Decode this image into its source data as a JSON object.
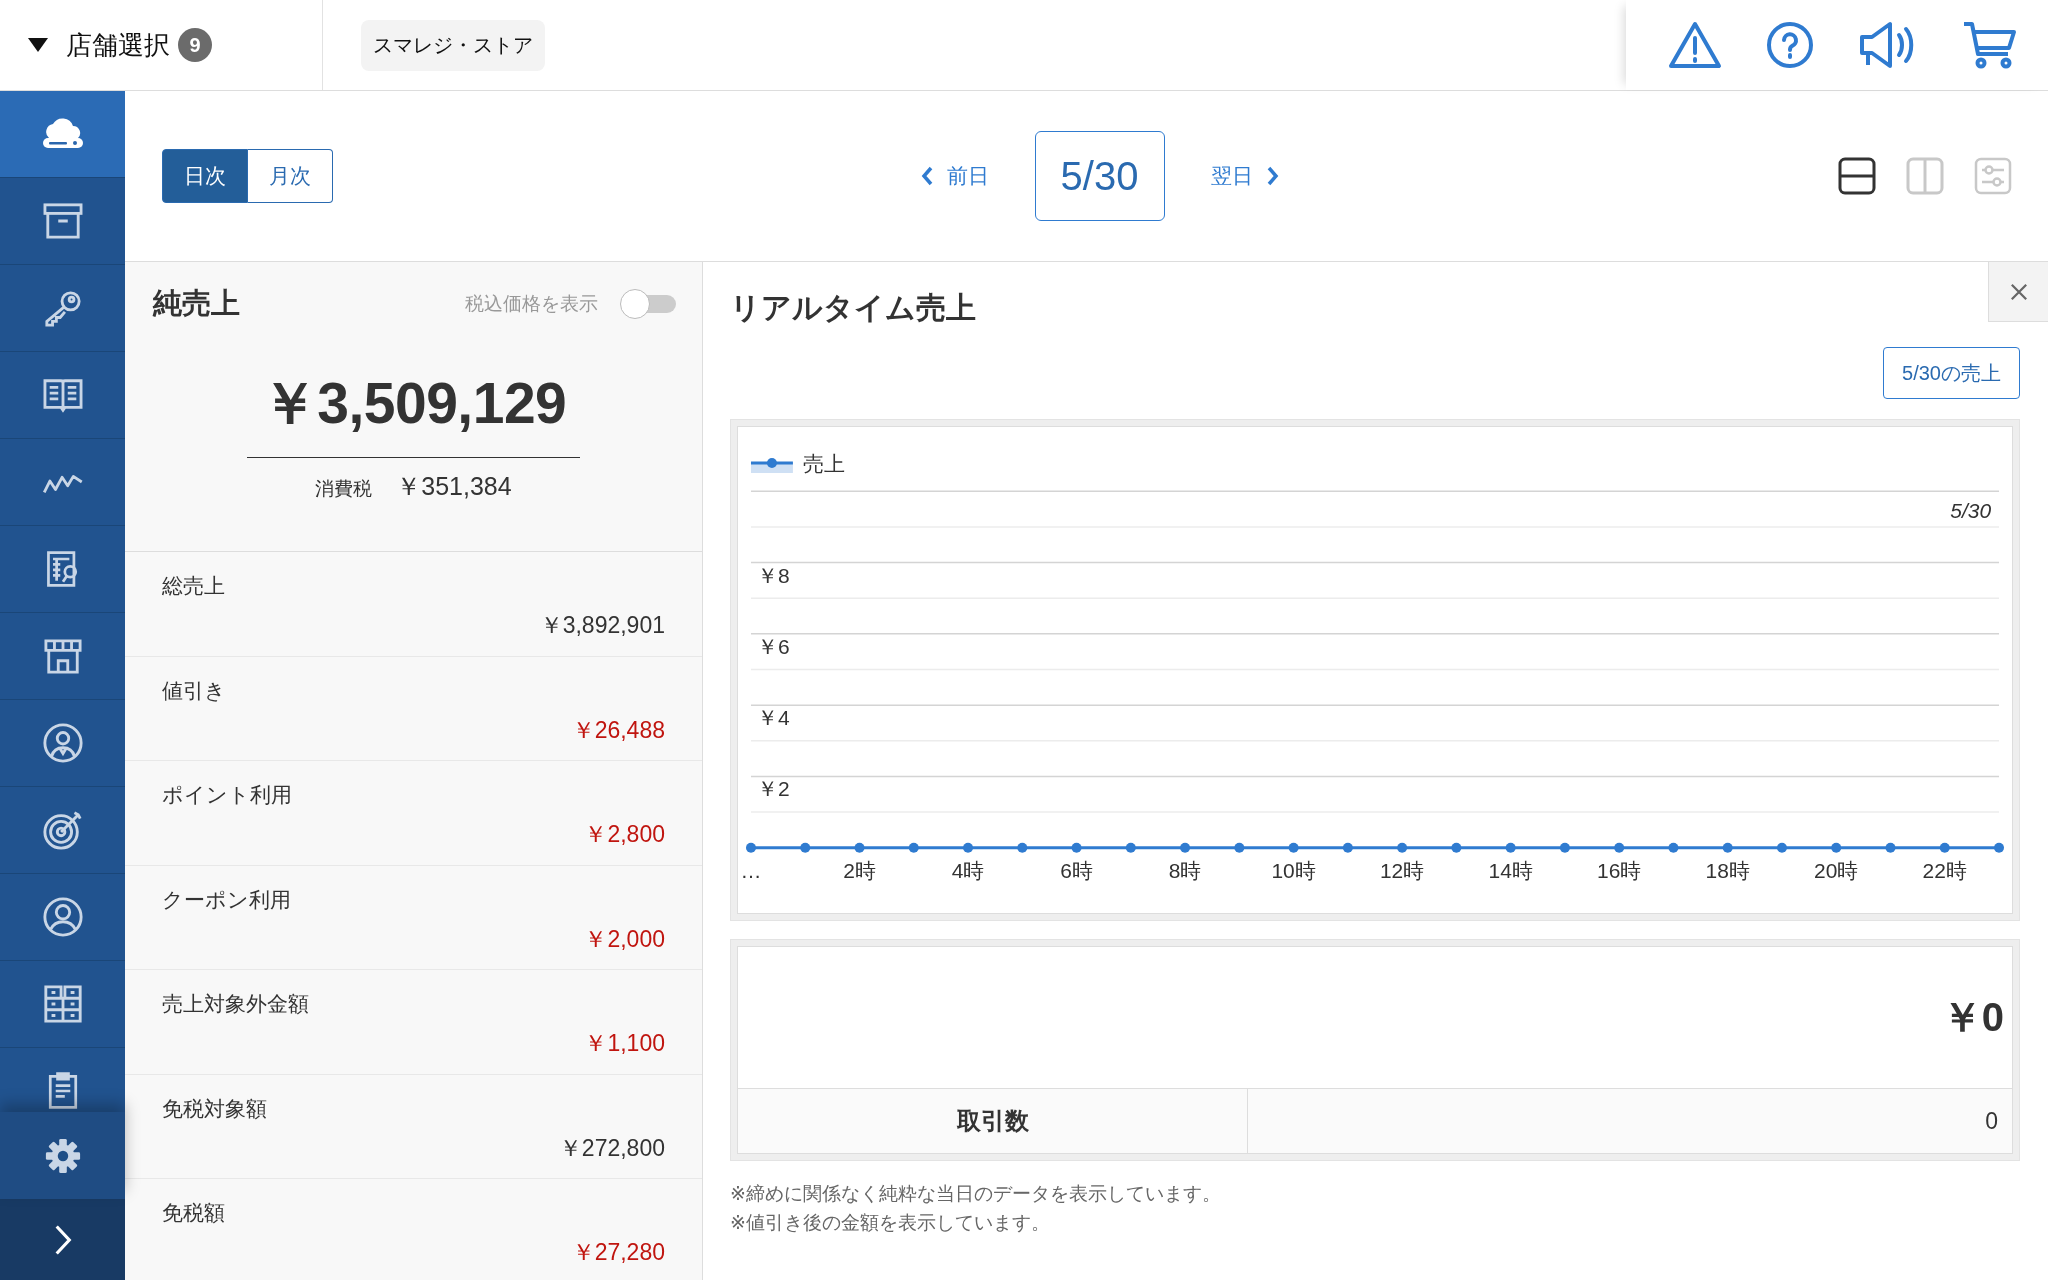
{
  "top_bar": {
    "store_select": {
      "label": "店舗選択",
      "count": "9"
    },
    "store_chip": "スマレジ・ストア",
    "actions": [
      {
        "kind": "warning"
      },
      {
        "kind": "help"
      },
      {
        "kind": "announce"
      },
      {
        "kind": "cart"
      }
    ]
  },
  "sidebar": {
    "items": [
      {
        "kind": "cloud",
        "selected": true
      },
      {
        "kind": "archive",
        "selected": false
      },
      {
        "kind": "key",
        "selected": false
      },
      {
        "kind": "book",
        "selected": false
      },
      {
        "kind": "trend",
        "selected": false
      },
      {
        "kind": "report",
        "selected": false
      },
      {
        "kind": "store",
        "selected": false
      },
      {
        "kind": "staff",
        "selected": false
      },
      {
        "kind": "target",
        "selected": false
      },
      {
        "kind": "user",
        "selected": false
      },
      {
        "kind": "grid",
        "selected": false
      },
      {
        "kind": "clipboard",
        "selected": false
      }
    ]
  },
  "period_tabs": [
    {
      "label": "日次",
      "selected": true
    },
    {
      "label": "月次",
      "selected": false
    }
  ],
  "date_nav": {
    "prev": "前日",
    "date": "5/30",
    "next": "翌日"
  },
  "view_modes": [
    {
      "kind": "rows",
      "selected": true
    },
    {
      "kind": "columns",
      "selected": false
    },
    {
      "kind": "sliders",
      "selected": false
    }
  ],
  "net_sales": {
    "title": "純売上",
    "tax_toggle": {
      "label": "税込価格を表示",
      "on": false
    },
    "amount": "￥3,509,129",
    "tax_label": "消費税",
    "tax_amount": "￥351,384",
    "rows": [
      {
        "label": "総売上",
        "value": "￥3,892,901",
        "color": "#333333"
      },
      {
        "label": "値引き",
        "value": "￥26,488",
        "color": "#c0150f"
      },
      {
        "label": "ポイント利用",
        "value": "￥2,800",
        "color": "#c0150f"
      },
      {
        "label": "クーポン利用",
        "value": "￥2,000",
        "color": "#c0150f"
      },
      {
        "label": "売上対象外金額",
        "value": "￥1,100",
        "color": "#c0150f"
      },
      {
        "label": "免税対象額",
        "value": "￥272,800",
        "color": "#333333"
      },
      {
        "label": "免税額",
        "value": "￥27,280",
        "color": "#c0150f"
      }
    ]
  },
  "realtime": {
    "title": "リアルタイム売上",
    "day_button": "5/30の売上",
    "chart_data": {
      "type": "line",
      "x": [
        0,
        1,
        2,
        3,
        4,
        5,
        6,
        7,
        8,
        9,
        10,
        11,
        12,
        13,
        14,
        15,
        16,
        17,
        18,
        19,
        20,
        21,
        22,
        23
      ],
      "series": [
        {
          "name": "売上",
          "color": "#2f7bd0",
          "marker": true,
          "values": [
            0,
            0,
            0,
            0,
            0,
            0,
            0,
            0,
            0,
            0,
            0,
            0,
            0,
            0,
            0,
            0,
            0,
            0,
            0,
            0,
            0,
            0,
            0,
            0
          ]
        }
      ],
      "xlim": [
        0,
        23
      ],
      "ylim": [
        0,
        10
      ],
      "grid": true,
      "xticks": [
        {
          "value": 0,
          "label": "…"
        },
        {
          "value": 2,
          "label": "2時"
        },
        {
          "value": 4,
          "label": "4時"
        },
        {
          "value": 6,
          "label": "6時"
        },
        {
          "value": 8,
          "label": "8時"
        },
        {
          "value": 10,
          "label": "10時"
        },
        {
          "value": 12,
          "label": "12時"
        },
        {
          "value": 14,
          "label": "14時"
        },
        {
          "value": 16,
          "label": "16時"
        },
        {
          "value": 18,
          "label": "18時"
        },
        {
          "value": 20,
          "label": "20時"
        },
        {
          "value": 22,
          "label": "22時"
        }
      ],
      "yticks": [
        {
          "value": 2,
          "label": "￥2"
        },
        {
          "value": 4,
          "label": "￥4"
        },
        {
          "value": 6,
          "label": "￥6"
        },
        {
          "value": 8,
          "label": "￥8"
        }
      ],
      "annotations": [
        "5/30"
      ]
    },
    "total": "￥0",
    "transactions_label": "取引数",
    "transactions": "0",
    "notes": [
      "※締めに関係なく純粋な当日のデータを表示しています。",
      "※値引き後の金額を表示しています。"
    ]
  }
}
